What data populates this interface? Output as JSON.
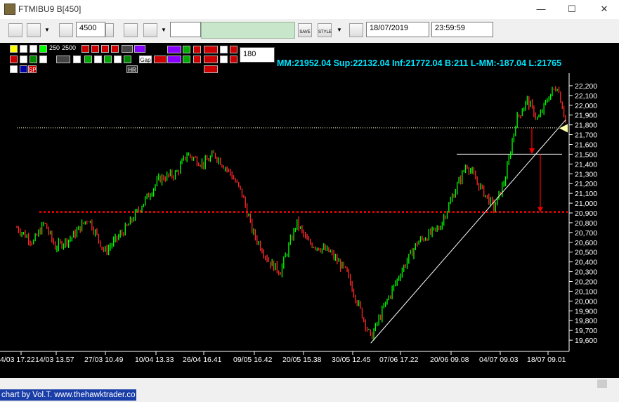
{
  "window": {
    "title": "FTMIBU9 B[450]"
  },
  "toolbar": {
    "bars_value": "4500",
    "date_value": "18/07/2019",
    "time_value": "23:59:59",
    "save_label": "SAVE",
    "style_label": "STYLE"
  },
  "controls": {
    "period_250": "250",
    "period_2500": "2500",
    "gap_label": "Gap",
    "hr_label": "HR",
    "sp_label": "SP",
    "input_value": "180"
  },
  "info": {
    "text": "MM:21952.04 Sup:22132.04 Inf:21772.04 B:211 L-MM:-187.04 L:21765"
  },
  "footer": {
    "credit": "chart by Vol.T. www.thehawktrader.co"
  },
  "colors": {
    "up": "#00ff00",
    "down": "#ff2a2a",
    "support": "#ff0000",
    "info": "#00e5ff",
    "background": "#000000"
  },
  "chart_data": {
    "type": "candlestick",
    "symbol": "FTMIBU9",
    "ylim": [
      19500,
      22300
    ],
    "y_ticks": [
      19600,
      19700,
      19800,
      19900,
      20000,
      20100,
      20200,
      20300,
      20400,
      20500,
      20600,
      20700,
      20800,
      20900,
      21000,
      21100,
      21200,
      21300,
      21400,
      21500,
      21600,
      21700,
      21800,
      21900,
      22000,
      22100,
      22200
    ],
    "x_ticks": [
      "4/03 17.22",
      "14/03 13.57",
      "27/03 10.49",
      "10/04 13.33",
      "26/04 16.41",
      "09/05 16.42",
      "20/05 15.38",
      "30/05 12.45",
      "07/06 17.22",
      "20/06 09.08",
      "04/07 09.03",
      "18/07 09.01"
    ],
    "price_path": [
      {
        "t": 0.0,
        "v": 20750
      },
      {
        "t": 0.03,
        "v": 20600
      },
      {
        "t": 0.05,
        "v": 20800
      },
      {
        "t": 0.07,
        "v": 20550
      },
      {
        "t": 0.1,
        "v": 20650
      },
      {
        "t": 0.13,
        "v": 20850
      },
      {
        "t": 0.16,
        "v": 20500
      },
      {
        "t": 0.2,
        "v": 20750
      },
      {
        "t": 0.23,
        "v": 21000
      },
      {
        "t": 0.26,
        "v": 21250
      },
      {
        "t": 0.29,
        "v": 21300
      },
      {
        "t": 0.31,
        "v": 21500
      },
      {
        "t": 0.34,
        "v": 21400
      },
      {
        "t": 0.36,
        "v": 21500
      },
      {
        "t": 0.39,
        "v": 21300
      },
      {
        "t": 0.41,
        "v": 21100
      },
      {
        "t": 0.43,
        "v": 20700
      },
      {
        "t": 0.46,
        "v": 20400
      },
      {
        "t": 0.48,
        "v": 20300
      },
      {
        "t": 0.51,
        "v": 20800
      },
      {
        "t": 0.53,
        "v": 20600
      },
      {
        "t": 0.57,
        "v": 20500
      },
      {
        "t": 0.6,
        "v": 20300
      },
      {
        "t": 0.62,
        "v": 20000
      },
      {
        "t": 0.645,
        "v": 19620
      },
      {
        "t": 0.67,
        "v": 19950
      },
      {
        "t": 0.7,
        "v": 20300
      },
      {
        "t": 0.73,
        "v": 20600
      },
      {
        "t": 0.77,
        "v": 20750
      },
      {
        "t": 0.8,
        "v": 21150
      },
      {
        "t": 0.82,
        "v": 21400
      },
      {
        "t": 0.84,
        "v": 21200
      },
      {
        "t": 0.87,
        "v": 20950
      },
      {
        "t": 0.89,
        "v": 21250
      },
      {
        "t": 0.91,
        "v": 21850
      },
      {
        "t": 0.93,
        "v": 22050
      },
      {
        "t": 0.95,
        "v": 21850
      },
      {
        "t": 0.97,
        "v": 22100
      },
      {
        "t": 0.985,
        "v": 22200
      },
      {
        "t": 1.0,
        "v": 21850
      }
    ],
    "support_level": 20910,
    "reference_levels": [
      21770,
      21500
    ],
    "trendline": {
      "from": {
        "t": 0.645,
        "v": 19570
      },
      "to": {
        "t": 1.0,
        "v": 21850
      }
    },
    "grid": false
  }
}
